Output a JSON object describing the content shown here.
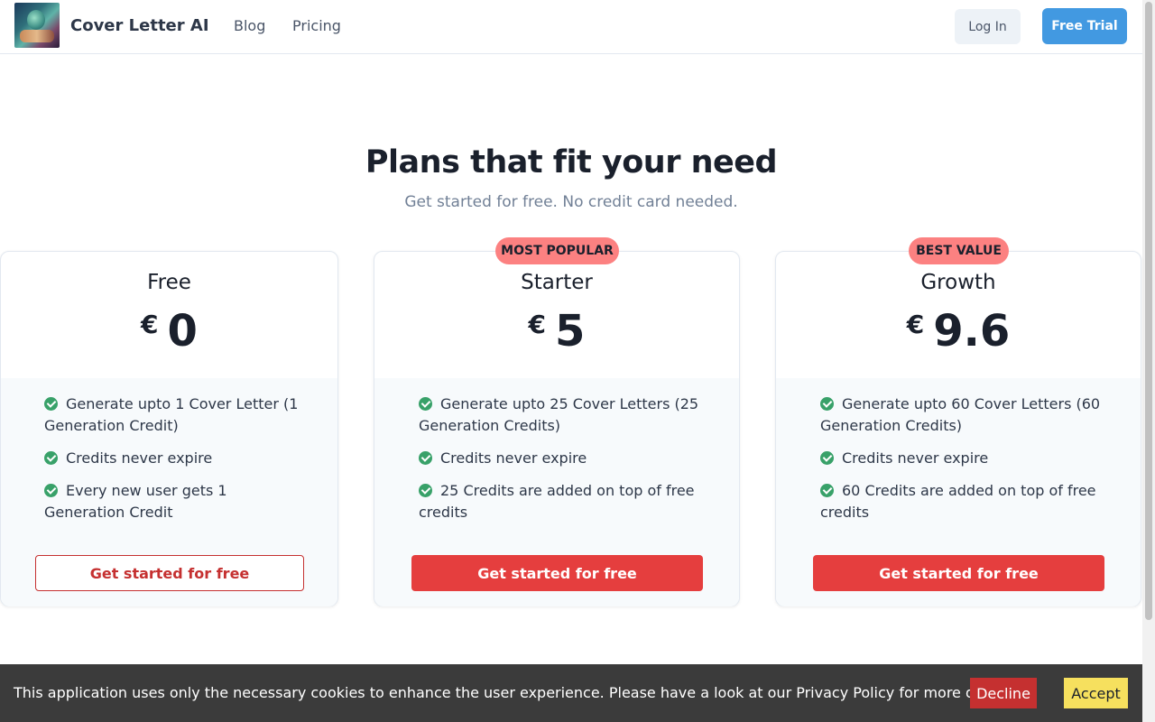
{
  "nav": {
    "brand": "Cover Letter AI",
    "links": [
      "Blog",
      "Pricing"
    ],
    "login_label": "Log In",
    "trial_label": "Free Trial"
  },
  "hero": {
    "title": "Plans that fit your need",
    "subtitle": "Get started for free. No credit card needed."
  },
  "plans": [
    {
      "name": "Free",
      "currency": "€",
      "price": "0",
      "badge": "",
      "features": [
        "Generate upto 1 Cover Letter (1 Generation Credit)",
        "Credits never expire",
        "Every new user gets 1 Generation Credit"
      ],
      "cta": "Get started for free"
    },
    {
      "name": "Starter",
      "currency": "€",
      "price": "5",
      "badge": "MOST POPULAR",
      "features": [
        "Generate upto 25 Cover Letters (25 Generation Credits)",
        "Credits never expire",
        "25 Credits are added on top of free credits"
      ],
      "cta": "Get started for free"
    },
    {
      "name": "Growth",
      "currency": "€",
      "price": "9.6",
      "badge": "BEST VALUE",
      "features": [
        "Generate upto 60 Cover Letters (60 Generation Credits)",
        "Credits never expire",
        "60 Credits are added on top of free credits"
      ],
      "cta": "Get started for free"
    }
  ],
  "cookie": {
    "text": "This application uses only the necessary cookies to enhance the user experience. Please have a look at our Privacy Policy for more details.",
    "decline_label": "Decline",
    "accept_label": "Accept"
  },
  "colors": {
    "accent_blue": "#4299e1",
    "cta_red": "#e53e3e",
    "badge_pink": "#fc8181",
    "check_green": "#38a169",
    "accept_yellow": "#f6e05e"
  }
}
